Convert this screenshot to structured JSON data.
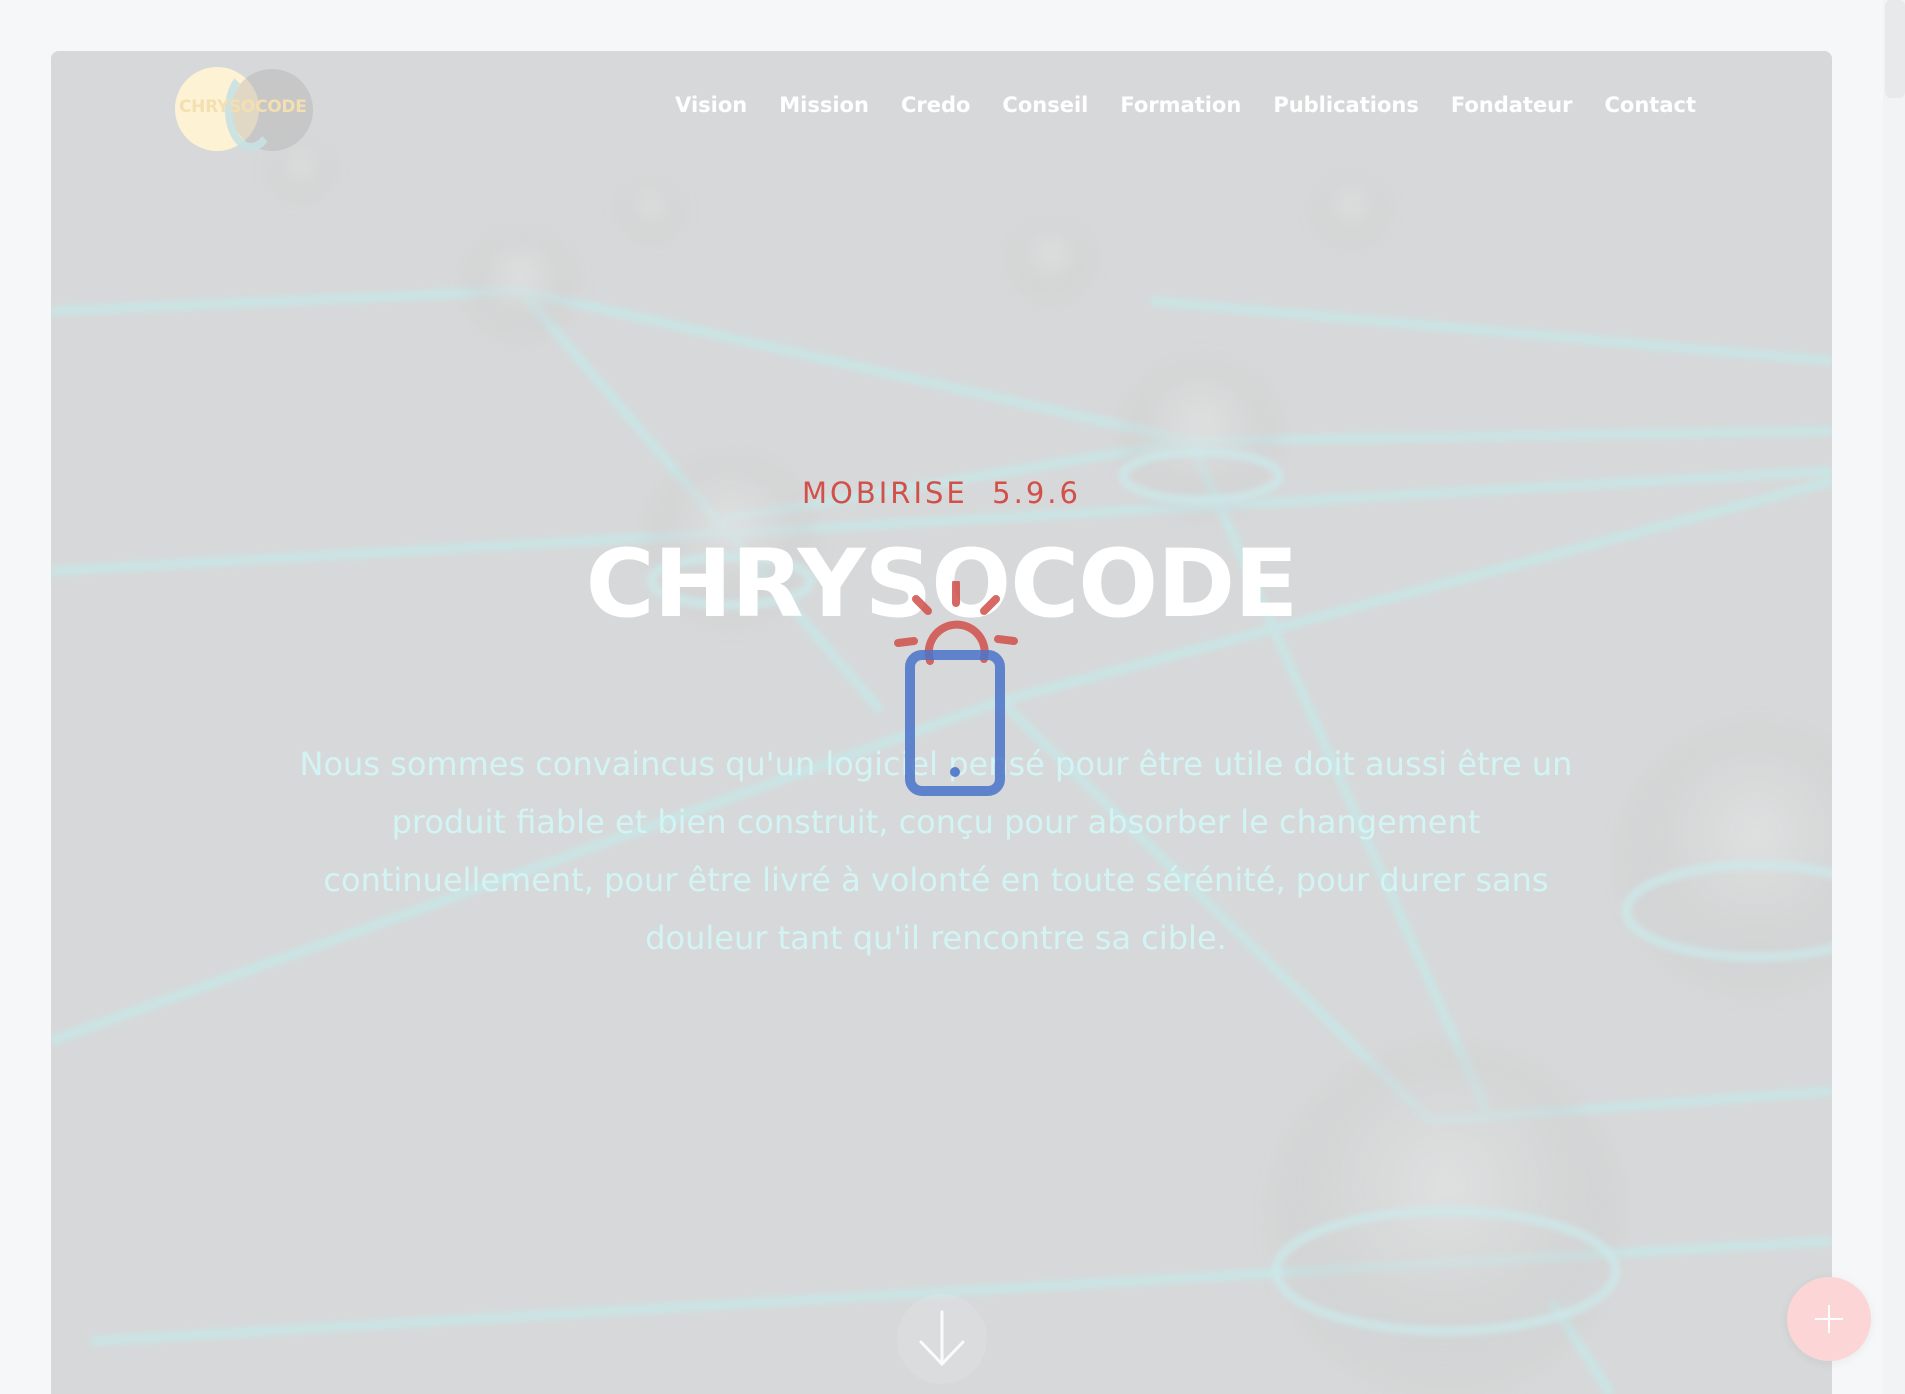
{
  "header": {
    "logo_text": "CHRYSOCODE",
    "nav": [
      {
        "label": "Vision"
      },
      {
        "label": "Mission"
      },
      {
        "label": "Credo"
      },
      {
        "label": "Conseil"
      },
      {
        "label": "Formation"
      },
      {
        "label": "Publications"
      },
      {
        "label": "Fondateur"
      },
      {
        "label": "Contact"
      }
    ]
  },
  "hero": {
    "eyebrow": "MOBIRISE  5.9.6",
    "title": "CHRYSOCODE",
    "lead": "Nous sommes convaincus qu'un logiciel pensé pour être utile doit aussi être un produit fiable et bien construit, conçu pour absorber le changement continuellement, pour être livré à volonté en toute sérénité, pour durer sans douleur tant qu'il rencontre sa cible."
  },
  "colors": {
    "accent_red": "#d1504a",
    "accent_blue": "#4a73c9",
    "lead_text": "#d3f4f4",
    "fab": "#fcd5d6"
  },
  "icons": {
    "preloader": "lightbulb-phone-icon",
    "scroll_down": "arrow-down-icon",
    "fab": "plus-icon"
  }
}
